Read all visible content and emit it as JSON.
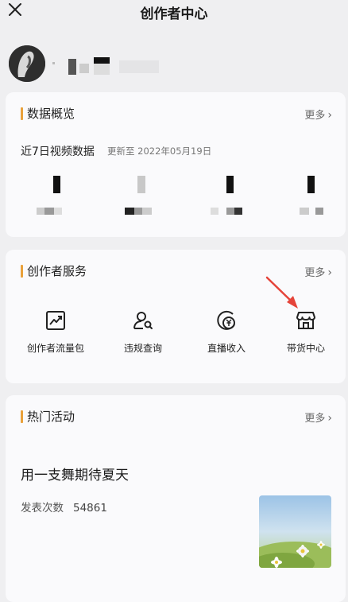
{
  "header": {
    "title": "创作者中心",
    "close_icon": "close-icon"
  },
  "profile": {
    "avatar_icon": "avatar"
  },
  "data_overview": {
    "title": "数据概览",
    "more": "更多",
    "subtitle": "近7日视频数据",
    "updated": "更新至 2022年05月19日"
  },
  "creator_services": {
    "title": "创作者服务",
    "more": "更多",
    "items": [
      {
        "label": "创作者流量包",
        "icon": "trend-chart-icon"
      },
      {
        "label": "违规查询",
        "icon": "user-search-icon"
      },
      {
        "label": "直播收入",
        "icon": "yuan-coin-icon"
      },
      {
        "label": "带货中心",
        "icon": "store-icon"
      }
    ]
  },
  "hot_activities": {
    "title": "热门活动",
    "more": "更多",
    "activity_title": "用一支舞期待夏天",
    "count_label": "发表次数",
    "count_value": "54861"
  },
  "colors": {
    "accent": "#e9a13b",
    "annotation_arrow": "#e5443a",
    "background": "#efeff1",
    "card": "#fafafc"
  }
}
